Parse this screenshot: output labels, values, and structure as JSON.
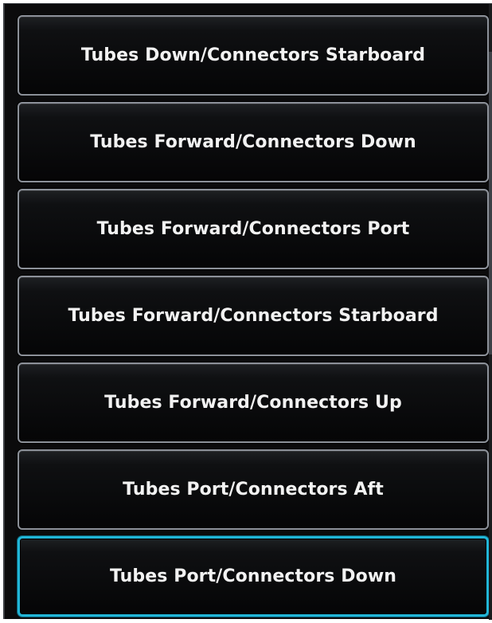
{
  "option_list": {
    "items": [
      {
        "label": "Tubes Down/Connectors Starboard",
        "selected": false
      },
      {
        "label": "Tubes Forward/Connectors Down",
        "selected": false
      },
      {
        "label": "Tubes Forward/Connectors Port",
        "selected": false
      },
      {
        "label": "Tubes Forward/Connectors Starboard",
        "selected": false
      },
      {
        "label": "Tubes Forward/Connectors Up",
        "selected": false
      },
      {
        "label": "Tubes Port/Connectors Aft",
        "selected": false
      },
      {
        "label": "Tubes Port/Connectors Down",
        "selected": true
      }
    ]
  },
  "colors": {
    "background": "#0b0b0c",
    "button_border": "#8c9199",
    "selected_border": "#21b6d8",
    "text": "#f2f2f2"
  }
}
